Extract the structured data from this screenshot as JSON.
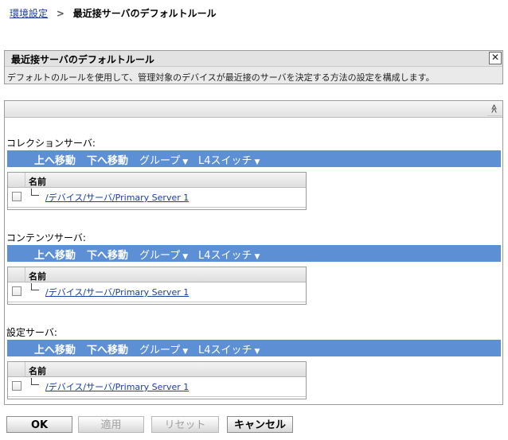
{
  "breadcrumb": {
    "parent": "環境設定",
    "separator": ">",
    "current": "最近接サーバのデフォルトルール"
  },
  "info_panel": {
    "title": "最近接サーバのデフォルトルール",
    "close_glyph": "✕",
    "description": "デフォルトのルールを使用して、管理対象のデバイスが最近接のサーバを決定する方法の設定を構成します。"
  },
  "main_panel": {
    "collapse_glyph": "≫"
  },
  "toolbar": {
    "move_up": "上へ移動",
    "move_down": "下へ移動",
    "group": "グループ",
    "l4_switch": "L4スイッチ",
    "dropdown_glyph": "▼"
  },
  "sections": [
    {
      "label": "コレクションサーバ:",
      "column_header": "名前",
      "rows": [
        {
          "name": "/デバイス/サーバ/Primary Server 1"
        }
      ]
    },
    {
      "label": "コンテンツサーバ:",
      "column_header": "名前",
      "rows": [
        {
          "name": "/デバイス/サーバ/Primary Server 1"
        }
      ]
    },
    {
      "label": "設定サーバ:",
      "column_header": "名前",
      "rows": [
        {
          "name": "/デバイス/サーバ/Primary Server 1"
        }
      ]
    }
  ],
  "buttons": {
    "ok": "OK",
    "apply": "適用",
    "reset": "リセット",
    "cancel": "キャンセル"
  },
  "colors": {
    "toolbar_bg": "#5d8fd4",
    "link": "#1a3d9e"
  }
}
